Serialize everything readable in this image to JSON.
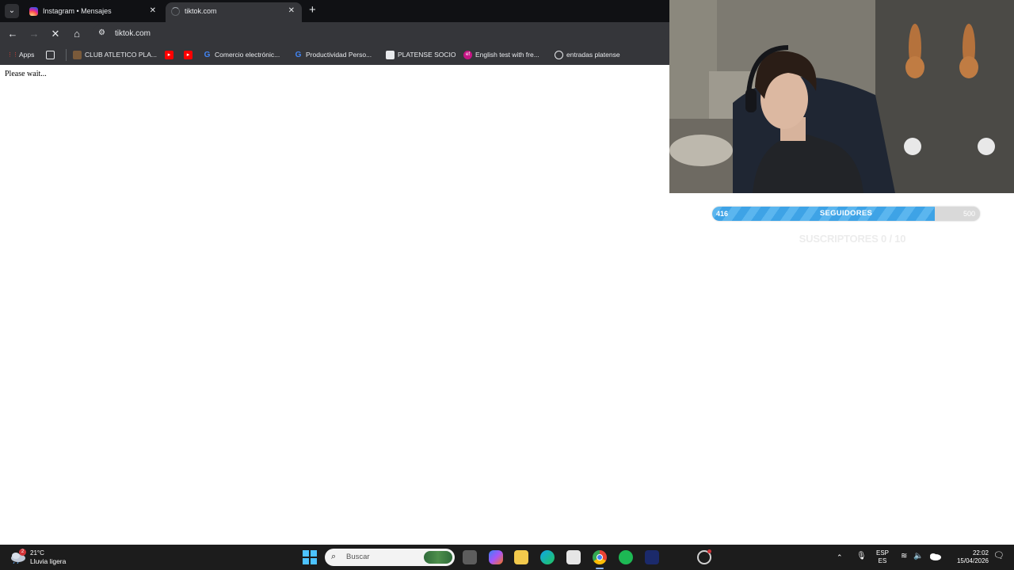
{
  "browser": {
    "tabs": [
      {
        "title": "Instagram • Mensajes",
        "active": false,
        "favicon": "instagram-icon",
        "color": "#e1306c"
      },
      {
        "title": "tiktok.com",
        "active": true,
        "favicon": "loading-icon",
        "color": "#9aa0a6"
      }
    ],
    "address": "tiktok.com",
    "bookmarks": [
      {
        "label": "Apps",
        "icon": "apps-grid-icon"
      },
      {
        "label": "",
        "icon": "tab-groups-icon"
      },
      {
        "label": "CLUB ATLETICO PLA...",
        "icon": "club-crest-icon"
      },
      {
        "label": "",
        "icon": "youtube-icon"
      },
      {
        "label": "",
        "icon": "youtube-icon"
      },
      {
        "label": "Comercio electrónic...",
        "icon": "google-icon"
      },
      {
        "label": "Productividad Perso...",
        "icon": "google-icon"
      },
      {
        "label": "PLATENSE SOCIO",
        "icon": "platense-icon"
      },
      {
        "label": "English test with fre...",
        "icon": "ef-icon"
      },
      {
        "label": "entradas platense",
        "icon": "globe-icon"
      }
    ]
  },
  "page": {
    "message": "Please wait..."
  },
  "overlay": {
    "goal": {
      "current": "416",
      "label": "SEGUIDORES",
      "max": "500",
      "progress": 0.832,
      "color": "#3ea3e6"
    },
    "subs": "SUSCRIPTORES 0 / 10"
  },
  "taskbar": {
    "weather": {
      "temp": "21°C",
      "desc": "Lluvia ligera",
      "badge": "2"
    },
    "search_placeholder": "Buscar",
    "lang": {
      "top": "ESP",
      "bottom": "ES"
    },
    "clock": {
      "time": "22:02",
      "date": "15/04/2026"
    }
  }
}
